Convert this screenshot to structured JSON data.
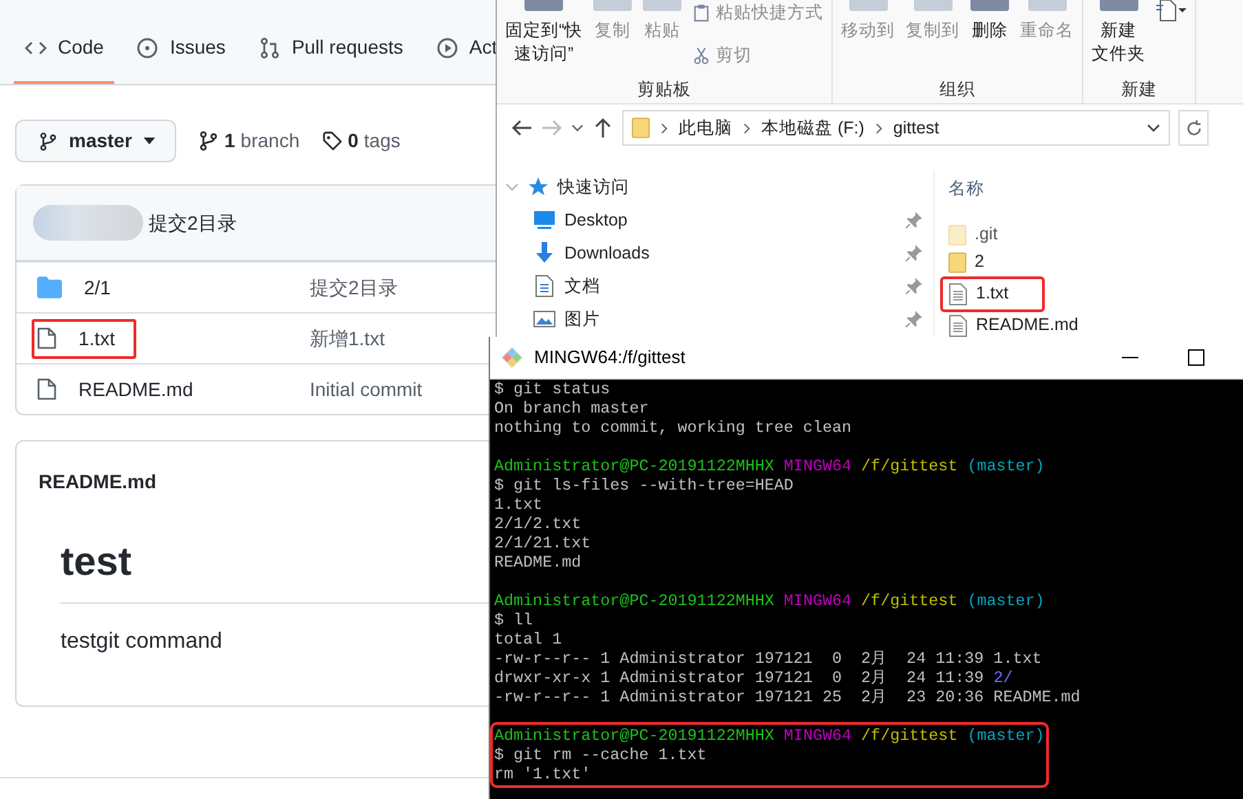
{
  "github": {
    "tabs": [
      {
        "label": "Code",
        "selected": true
      },
      {
        "label": "Issues",
        "selected": false
      },
      {
        "label": "Pull requests",
        "selected": false
      },
      {
        "label": "Act",
        "selected": false
      }
    ],
    "branch_button": "master",
    "branch_count": {
      "count": "1",
      "label": "branch"
    },
    "tag_count": {
      "count": "0",
      "label": "tags"
    },
    "latest_commit": {
      "message": "提交2目录"
    },
    "files": [
      {
        "kind": "folder",
        "name": "2/1",
        "commit": "提交2目录",
        "highlighted": false
      },
      {
        "kind": "file",
        "name": "1.txt",
        "commit": "新增1.txt",
        "highlighted": true
      },
      {
        "kind": "file",
        "name": "README.md",
        "commit": "Initial commit",
        "highlighted": false
      }
    ],
    "readme": {
      "filename": "README.md",
      "heading": "test",
      "body": "testgit command"
    }
  },
  "explorer": {
    "ribbon_groups": [
      {
        "label": "剪贴板",
        "items": [
          {
            "kind": "large",
            "label": [
              "固定到“快",
              "速访问”"
            ],
            "disabled": false
          },
          {
            "kind": "large",
            "label": [
              "复制"
            ],
            "disabled": true
          },
          {
            "kind": "large",
            "label": [
              "粘贴"
            ],
            "disabled": true
          },
          {
            "kind": "small",
            "label": "粘贴快捷方式",
            "disabled": true
          },
          {
            "kind": "small",
            "label": "剪切",
            "disabled": true
          }
        ]
      },
      {
        "label": "组织",
        "items": [
          {
            "kind": "large",
            "label": [
              "移动到"
            ],
            "disabled": true
          },
          {
            "kind": "large",
            "label": [
              "复制到"
            ],
            "disabled": true
          },
          {
            "kind": "large",
            "label": [
              "删除"
            ],
            "disabled": false
          },
          {
            "kind": "large",
            "label": [
              "重命名"
            ],
            "disabled": true
          }
        ]
      },
      {
        "label": "新建",
        "items": [
          {
            "kind": "large",
            "label": [
              "新建",
              "文件夹"
            ],
            "disabled": false
          },
          {
            "kind": "icon"
          }
        ]
      }
    ],
    "breadcrumbs": [
      "此电脑",
      "本地磁盘 (F:)",
      "gittest"
    ],
    "quick_access": {
      "label": "快速访问",
      "items": [
        {
          "kind": "desktop",
          "label": "Desktop"
        },
        {
          "kind": "download",
          "label": "Downloads"
        },
        {
          "kind": "document",
          "label": "文档"
        },
        {
          "kind": "picture",
          "label": "图片"
        }
      ]
    },
    "column_header": "名称",
    "files": [
      {
        "kind": "folder",
        "name": ".git",
        "hidden": true,
        "highlighted": false
      },
      {
        "kind": "folder",
        "name": "2",
        "hidden": false,
        "highlighted": false
      },
      {
        "kind": "file",
        "name": "1.txt",
        "hidden": false,
        "highlighted": true
      },
      {
        "kind": "file",
        "name": "README.md",
        "hidden": false,
        "highlighted": false
      }
    ]
  },
  "terminal": {
    "title": "MINGW64:/f/gittest",
    "blocks": [
      {
        "highlighted": false,
        "lines": [
          [
            {
              "text": "$ git status",
              "kind": "text"
            }
          ],
          [
            {
              "text": "On branch master",
              "kind": "text"
            }
          ],
          [
            {
              "text": "nothing to commit, working tree clean",
              "kind": "text"
            }
          ]
        ]
      },
      {
        "highlighted": false,
        "lines": [
          [
            {
              "text": "Administrator@PC-20191122MHHX",
              "kind": "user"
            },
            {
              "text": "MINGW64",
              "kind": "shell"
            },
            {
              "text": "/f/gittest",
              "kind": "path"
            },
            {
              "text": "(master)",
              "kind": "branch"
            }
          ],
          [
            {
              "text": "$ git ls-files --with-tree=HEAD",
              "kind": "text"
            }
          ],
          [
            {
              "text": "1.txt",
              "kind": "text"
            }
          ],
          [
            {
              "text": "2/1/2.txt",
              "kind": "text"
            }
          ],
          [
            {
              "text": "2/1/21.txt",
              "kind": "text"
            }
          ],
          [
            {
              "text": "README.md",
              "kind": "text"
            }
          ]
        ]
      },
      {
        "highlighted": false,
        "lines": [
          [
            {
              "text": "Administrator@PC-20191122MHHX",
              "kind": "user"
            },
            {
              "text": "MINGW64",
              "kind": "shell"
            },
            {
              "text": "/f/gittest",
              "kind": "path"
            },
            {
              "text": "(master)",
              "kind": "branch"
            }
          ],
          [
            {
              "text": "$ ll",
              "kind": "text"
            }
          ],
          [
            {
              "text": "total 1",
              "kind": "text"
            }
          ],
          [
            {
              "text": "-rw-r--r-- 1 Administrator 197121  0  2月  24 11:39 1.txt",
              "kind": "text"
            }
          ],
          [
            {
              "text": "drwxr-xr-x 1 Administrator 197121  0  2月  24 11:39",
              "kind": "text"
            },
            {
              "text": "2/",
              "kind": "dir"
            }
          ],
          [
            {
              "text": "-rw-r--r-- 1 Administrator 197121 25  2月  23 20:36 README.md",
              "kind": "text"
            }
          ]
        ]
      },
      {
        "highlighted": true,
        "lines": [
          [
            {
              "text": "Administrator@PC-20191122MHHX",
              "kind": "user"
            },
            {
              "text": "MINGW64",
              "kind": "shell"
            },
            {
              "text": "/f/gittest",
              "kind": "path"
            },
            {
              "text": "(master)",
              "kind": "branch"
            }
          ],
          [
            {
              "text": "$ git rm --cache 1.txt",
              "kind": "text"
            }
          ],
          [
            {
              "text": "rm '1.txt'",
              "kind": "text"
            }
          ]
        ]
      }
    ]
  }
}
